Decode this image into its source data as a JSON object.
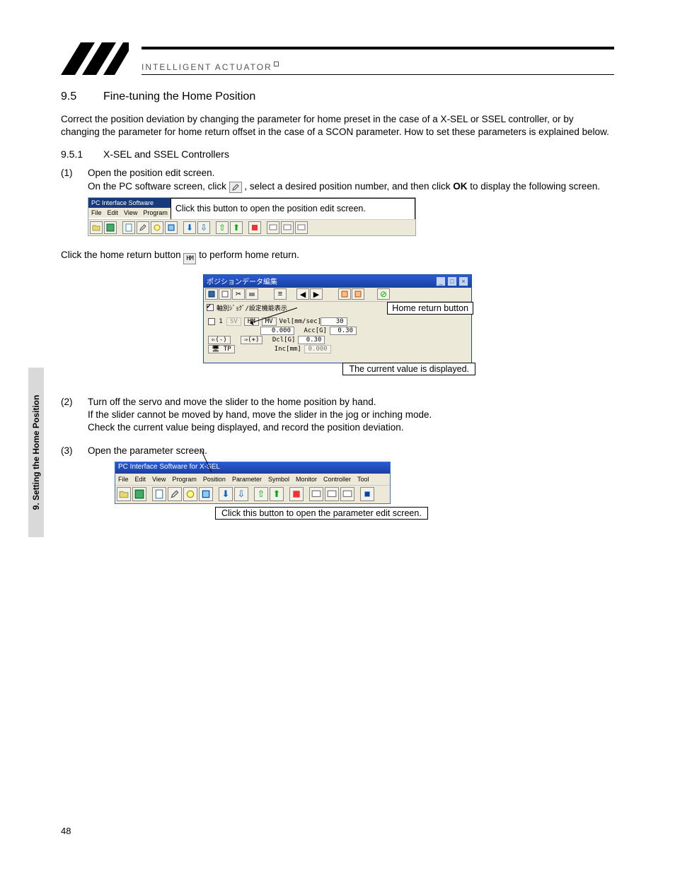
{
  "header": {
    "brand": "INTELLIGENT ACTUATOR"
  },
  "sidetab": {
    "label": "9. Setting the Home Position"
  },
  "section": {
    "num": "9.5",
    "title": "Fine-tuning the Home Position",
    "intro": "Correct the position deviation by changing the parameter for home preset in the case of a X-SEL or SSEL controller, or by changing the parameter for home return offset in the case of a SCON parameter. How to set these parameters is explained below.",
    "sub_num": "9.5.1",
    "sub_title": "X-SEL and SSEL Controllers"
  },
  "steps": {
    "s1_label": "(1)",
    "s1_line1": "Open the position edit screen.",
    "s1_line2a": "On the PC software screen, click ",
    "s1_line2b": ", select a desired position number, and then click ",
    "s1_ok": "OK",
    "s1_line2c": " to display the following screen.",
    "hr_line_a": "Click the home return button  ",
    "hr_line_b": "  to perform home return.",
    "s2_label": "(2)",
    "s2_line1": "Turn off the servo and move the slider to the home position by hand.",
    "s2_line2": "If the slider cannot be moved by hand, move the slider in the jog or inching mode.",
    "s2_line3": "Check the current value being displayed, and record the position deviation.",
    "s3_label": "(3)",
    "s3_line1": "Open the parameter screen."
  },
  "fig1": {
    "title": "PC Interface Software",
    "menus": [
      "File",
      "Edit",
      "View",
      "Program"
    ],
    "callout": "Click this button to open the position edit screen."
  },
  "fig2": {
    "title": "ポジションデータ編集",
    "opt_label": "軸別ｼﾞｮｸﾞ/設定機能表示",
    "callout_hr": "Home return button",
    "callout_cur": "The current value is displayed.",
    "rows": {
      "velLabel": "Vel[mm/sec]",
      "vel": "30",
      "cur": "0.000",
      "accLabel": "Acc[G]",
      "acc": "0.30",
      "dclLabel": "Dcl[G]",
      "dcl": "0.30",
      "incLabel": "Inc[mm]",
      "inc": "0.000",
      "hm": "HM",
      "mv": "MV",
      "jogminus": "⇐(-)",
      "jogplus": "⇒(+)",
      "tp": "TP"
    }
  },
  "fig3": {
    "title": "PC Interface Software for X-SEL",
    "menus": [
      "File",
      "Edit",
      "View",
      "Program",
      "Position",
      "Parameter",
      "Symbol",
      "Monitor",
      "Controller",
      "Tool"
    ],
    "callout": "Click this button to open the parameter edit screen."
  },
  "page_number": "48",
  "icons": {
    "hm_text": "HM"
  }
}
